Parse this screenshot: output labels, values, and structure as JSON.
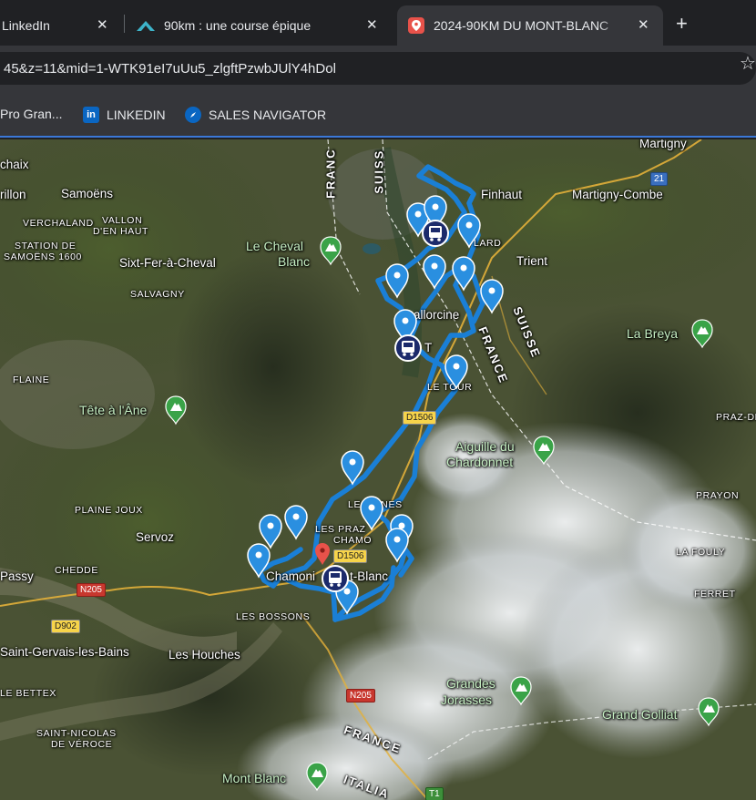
{
  "tabs": [
    {
      "title": "LinkedIn",
      "active": false
    },
    {
      "title": "90km : une course épique",
      "active": false
    },
    {
      "title": "2024-90KM DU MONT-BLANC",
      "active": true
    }
  ],
  "tab_close_glyph": "✕",
  "new_tab_glyph": "+",
  "address": {
    "url": "45&z=11&mid=1-WTK91eI7uUu5_zlgftPzwbJUlY4hDol"
  },
  "star_glyph": "☆",
  "bookmarks": [
    {
      "label": "Pro Gran...",
      "icon": "bookmark-icon"
    },
    {
      "label": "LINKEDIN",
      "icon": "linkedin-icon",
      "icon_text": "in"
    },
    {
      "label": "SALES NAVIGATOR",
      "icon": "compass-icon"
    }
  ],
  "map": {
    "places": {
      "martigny": "Martigny",
      "chaix": "chaix",
      "rillon": "rillon",
      "samoens": "Samoëns",
      "finhaut": "Finhaut",
      "martigny_combe": "Martigny-Combe",
      "verchaland": "VERCHALAND",
      "vallon_1": "VALLON",
      "vallon_2": "D'EN HAUT",
      "station_1": "STATION DE",
      "station_2": "SAMOËNS 1600",
      "sixt": "Sixt-Fer-à-Cheval",
      "trient": "Trient",
      "salvagny": "SALVAGNY",
      "vallorcine": "allorcine",
      "t": "T",
      "flaine": "FLAINE",
      "le_tour": "LE TOUR",
      "praz_de": "PRAZ-DE",
      "plaine_joux": "PLAINE JOUX",
      "les_bines": "LES BINES",
      "les_praz": "LES PRAZ",
      "chamonix_top": "CHAMO",
      "servoz": "Servoz",
      "chedde": "CHEDDE",
      "passy": "Passy",
      "chamonix": "Chamoni",
      "mont_blanc_town": "t-Blanc",
      "la_fouly": "LA FOULY",
      "praion": "PRAYON",
      "ferret": "FERRET",
      "les_bossons": "LES BOSSONS",
      "saint_gervais": "Saint-Gervais-les-Bains",
      "les_houches": "Les Houches",
      "le_bettex": "LE BETTEX",
      "saint_nicolas_1": "SAINT-NICOLAS",
      "saint_nicolas_2": "DE VÉROCE",
      "lard": "LARD"
    },
    "pois": {
      "cheval_blanc_1": "Le Cheval",
      "cheval_blanc_2": "Blanc",
      "la_breya": "La Breya",
      "tete_ane": "Tête à l'Âne",
      "chardonnet_1": "Aiguille du",
      "chardonnet_2": "Chardonnet",
      "grandes_jorasses_1": "Grandes",
      "grandes_jorasses_2": "Jorasses",
      "grand_golliat": "Grand Golliat",
      "mont_blanc": "Mont Blanc"
    },
    "borders": {
      "france_1": "FRANC",
      "suisse_1": "SUISS",
      "suisse_2": "SUISSE",
      "france_2": "FRANCE",
      "france_3": "FRANCE",
      "italia": "ITALIA"
    },
    "roads": {
      "r21": "21",
      "d1506_a": "D1506",
      "d1506_b": "D1506",
      "n205_a": "N205",
      "d902": "D902",
      "n205_b": "N205",
      "t1": "T1"
    },
    "colors": {
      "route": "#1a7fd6",
      "marker": "#2a8fe0",
      "bus_marker": "#1b2a6b",
      "selected_marker": "#e8524a",
      "poi": "#3aa348"
    }
  }
}
